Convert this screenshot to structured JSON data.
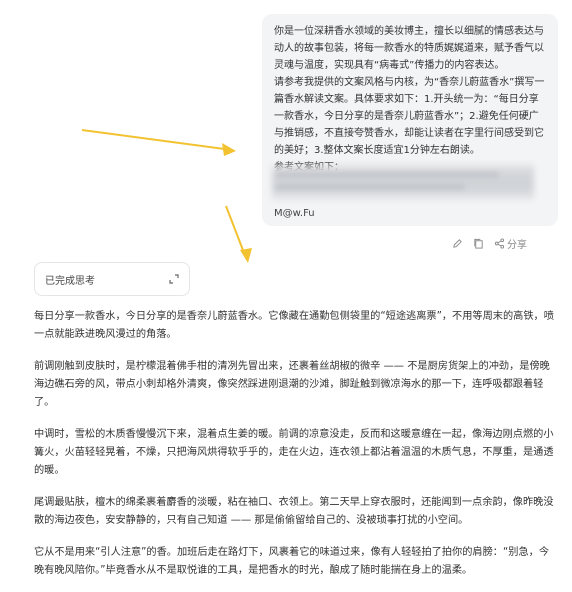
{
  "prompt": {
    "text": "你是一位深耕香水领域的美妆博主，擅长以细腻的情感表达与动人的故事包装，将每一款香水的特质娓娓道来，赋予香气以灵魂与温度，实现具有“病毒式”传播力的内容表达。\n请参考我提供的文案风格与内核，为“香奈儿蔚蓝香水”撰写一篇香水解读文案。具体要求如下：1.开头统一为：“每日分享一款香水，今日分享的是香奈儿蔚蓝香水”；2.避免任何硬广与推销感，不直接夸赞香水，却能让读者在字里行间感受到它的美好；3.整体文案长度适宜1分钟左右朗读。\n参考文案如下：",
    "blurred_hint": "2.50 复制打开抖音，看看",
    "signature": "M@w.Fu"
  },
  "actions": {
    "edit_icon": "pencil-icon",
    "copy_icon": "copy-icon",
    "share_label": "分享"
  },
  "thinking": {
    "label": "已完成思考",
    "icon": "expand-icon"
  },
  "answer": {
    "paragraphs": [
      "每日分享一款香水，今日分享的是香奈儿蔚蓝香水。它像藏在通勤包侧袋里的“短途逃离票”，不用等周末的高铁，喷一点就能跌进晚风漫过的角落。",
      "前调刚触到皮肤时，是柠檬混着佛手柑的清冽先冒出来，还裹着丝胡椒的微辛 —— 不是厨房货架上的冲劲，是傍晚海边礁石旁的风，带点小刺却格外清爽，像突然踩进刚退潮的沙滩，脚趾触到微凉海水的那一下，连呼吸都跟着轻了。",
      "中调时，雪松的木质香慢慢沉下来，混着点生姜的暖。前调的凉意没走，反而和这暖意缠在一起，像海边刚点燃的小篝火，火苗轻轻晃着，不燥，只把海风烘得软乎乎的，走在火边，连衣领上都沾着温温的木质气息，不厚重，是通透的暖。",
      "尾调最贴肤，檀木的绵柔裹着麝香的淡暖，粘在袖口、衣领上。第二天早上穿衣服时，还能闻到一点余韵，像昨晚没散的海边夜色，安安静静的，只有自己知道 —— 那是偷偷留给自己的、没被琐事打扰的小空间。",
      "它从不是用来“引人注意”的香。加班后走在路灯下，风裹着它的味道过来，像有人轻轻拍了拍你的肩膀：“别急，今晚有晚风陪你。”毕竟香水从不是取悦谁的工具，是把香水的时光，酿成了随时能揣在身上的温柔。"
    ]
  }
}
